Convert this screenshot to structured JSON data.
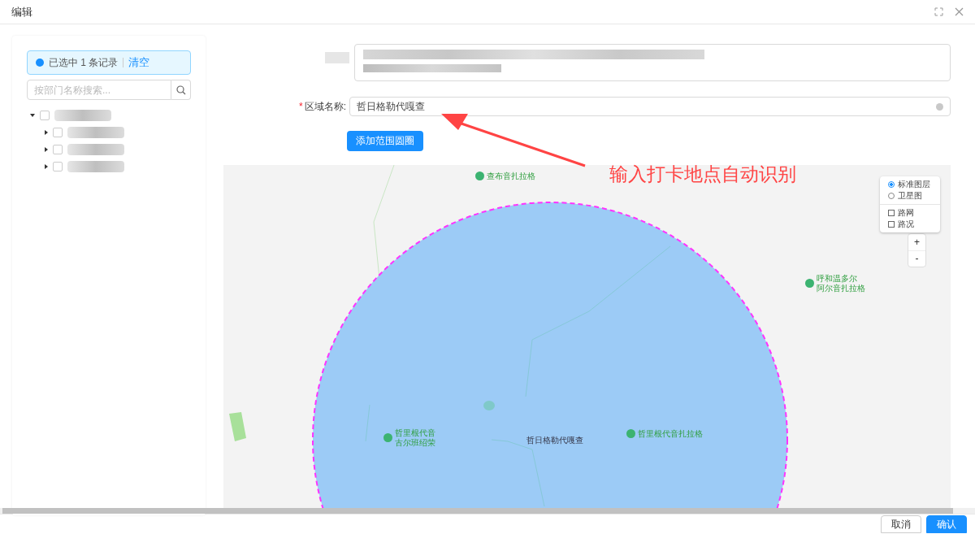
{
  "dialog": {
    "title": "编辑"
  },
  "left_panel": {
    "selection_alert": {
      "text": "已选中 1 条记录",
      "action": "清空"
    },
    "search": {
      "placeholder": "按部门名称搜索..."
    },
    "tree": [
      {
        "checked": false,
        "expanded": true,
        "children": [
          {
            "checked": false,
            "expanded": false
          },
          {
            "checked": false,
            "expanded": false
          },
          {
            "checked": false,
            "expanded": false
          }
        ]
      }
    ]
  },
  "form": {
    "area_name": {
      "required_mark": "*",
      "label": "区域名称:",
      "value": "哲日格勒代嘎查"
    },
    "add_button": "添加范围圆圈"
  },
  "map": {
    "layers": [
      {
        "label": "标准图层",
        "selected": true
      },
      {
        "label": "卫星图",
        "selected": false
      }
    ],
    "overlays": [
      {
        "label": "路网",
        "checked": false
      },
      {
        "label": "路况",
        "checked": false
      }
    ],
    "zoom": [
      "+",
      "-"
    ],
    "places": [
      {
        "kind": "poi",
        "lines": [
          "查布音扎拉格"
        ]
      },
      {
        "kind": "poi",
        "lines": [
          "呼和温多尔",
          "阿尔音扎拉格"
        ]
      },
      {
        "kind": "poi",
        "lines": [
          "哲里根代音",
          "古尔班绍荣"
        ]
      },
      {
        "kind": "label",
        "lines": [
          "哲日格勒代嘎查"
        ]
      },
      {
        "kind": "poi",
        "lines": [
          "哲里根代音扎拉格"
        ]
      }
    ]
  },
  "annotation": {
    "text": "输入打卡地点自动识别"
  },
  "footer": {
    "buttons": [
      {
        "label": "取消",
        "kind": "default"
      },
      {
        "label": "确认",
        "kind": "primary"
      }
    ]
  }
}
